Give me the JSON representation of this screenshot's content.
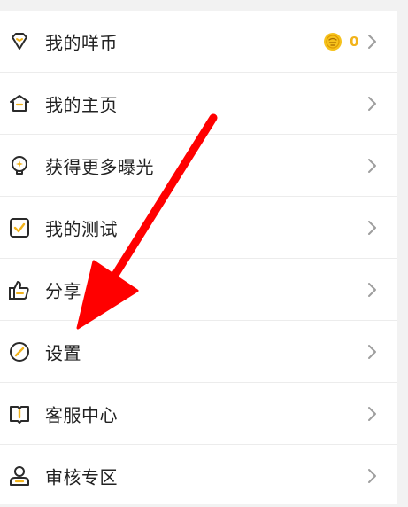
{
  "colors": {
    "accent": "#f2b31b",
    "icon_stroke": "#2a2a2a",
    "arrow": "#ff0000",
    "chevron": "#9e9e9e"
  },
  "menu": {
    "items": [
      {
        "label": "我的咩币",
        "icon": "diamond-icon",
        "coin_count": "0"
      },
      {
        "label": "我的主页",
        "icon": "home-icon"
      },
      {
        "label": "获得更多曝光",
        "icon": "lightbulb-icon"
      },
      {
        "label": "我的测试",
        "icon": "checkbox-icon"
      },
      {
        "label": "分享",
        "icon": "thumbs-up-icon"
      },
      {
        "label": "设置",
        "icon": "compass-icon"
      },
      {
        "label": "客服中心",
        "icon": "book-icon"
      },
      {
        "label": "审核专区",
        "icon": "reviewer-icon"
      }
    ]
  },
  "annotation": {
    "icon": "red-arrow-icon"
  }
}
